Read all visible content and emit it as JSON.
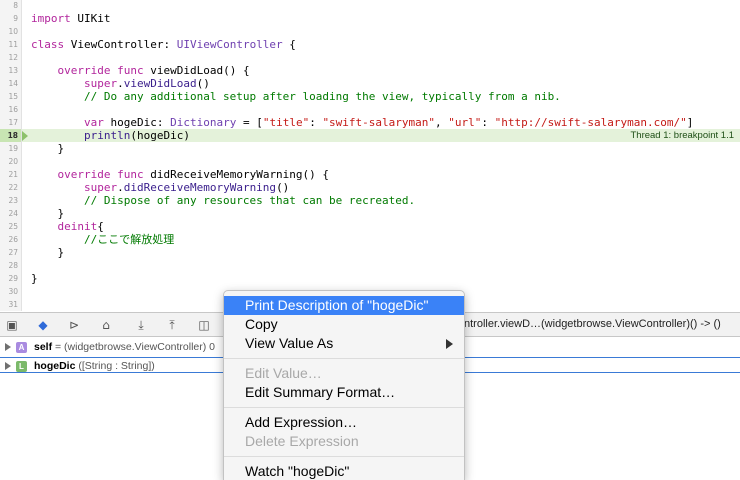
{
  "editor": {
    "lines": [
      {
        "n": "8",
        "tokens": []
      },
      {
        "n": "9",
        "tokens": [
          {
            "c": "kw",
            "t": "import"
          },
          {
            "c": "",
            "t": " UIKit"
          }
        ]
      },
      {
        "n": "10",
        "tokens": []
      },
      {
        "n": "11",
        "tokens": [
          {
            "c": "kw",
            "t": "class"
          },
          {
            "c": "",
            "t": " ViewController: "
          },
          {
            "c": "ty",
            "t": "UIViewController"
          },
          {
            "c": "",
            "t": " {"
          }
        ]
      },
      {
        "n": "12",
        "tokens": []
      },
      {
        "n": "13",
        "tokens": [
          {
            "c": "",
            "t": "    "
          },
          {
            "c": "kw",
            "t": "override"
          },
          {
            "c": "",
            "t": " "
          },
          {
            "c": "kw",
            "t": "func"
          },
          {
            "c": "",
            "t": " viewDidLoad() {"
          }
        ]
      },
      {
        "n": "14",
        "tokens": [
          {
            "c": "",
            "t": "        "
          },
          {
            "c": "kw",
            "t": "super"
          },
          {
            "c": "",
            "t": "."
          },
          {
            "c": "fn",
            "t": "viewDidLoad"
          },
          {
            "c": "",
            "t": "()"
          }
        ]
      },
      {
        "n": "15",
        "tokens": [
          {
            "c": "",
            "t": "        "
          },
          {
            "c": "cm",
            "t": "// Do any additional setup after loading the view, typically from a nib."
          }
        ]
      },
      {
        "n": "16",
        "tokens": []
      },
      {
        "n": "17",
        "tokens": [
          {
            "c": "",
            "t": "        "
          },
          {
            "c": "kw",
            "t": "var"
          },
          {
            "c": "",
            "t": " hogeDic: "
          },
          {
            "c": "ty",
            "t": "Dictionary"
          },
          {
            "c": "",
            "t": " = ["
          },
          {
            "c": "str",
            "t": "\"title\""
          },
          {
            "c": "",
            "t": ": "
          },
          {
            "c": "str",
            "t": "\"swift-salaryman\""
          },
          {
            "c": "",
            "t": ", "
          },
          {
            "c": "str",
            "t": "\"url\""
          },
          {
            "c": "",
            "t": ": "
          },
          {
            "c": "str",
            "t": "\"http://swift-salaryman.com/\""
          },
          {
            "c": "",
            "t": "]"
          }
        ]
      },
      {
        "n": "18",
        "tokens": [
          {
            "c": "",
            "t": "        "
          },
          {
            "c": "fn",
            "t": "println"
          },
          {
            "c": "",
            "t": "(hogeDic)"
          }
        ],
        "current": true
      },
      {
        "n": "19",
        "tokens": [
          {
            "c": "",
            "t": "    }"
          }
        ]
      },
      {
        "n": "20",
        "tokens": []
      },
      {
        "n": "21",
        "tokens": [
          {
            "c": "",
            "t": "    "
          },
          {
            "c": "kw",
            "t": "override"
          },
          {
            "c": "",
            "t": " "
          },
          {
            "c": "kw",
            "t": "func"
          },
          {
            "c": "",
            "t": " didReceiveMemoryWarning() {"
          }
        ]
      },
      {
        "n": "22",
        "tokens": [
          {
            "c": "",
            "t": "        "
          },
          {
            "c": "kw",
            "t": "super"
          },
          {
            "c": "",
            "t": "."
          },
          {
            "c": "fn",
            "t": "didReceiveMemoryWarning"
          },
          {
            "c": "",
            "t": "()"
          }
        ]
      },
      {
        "n": "23",
        "tokens": [
          {
            "c": "",
            "t": "        "
          },
          {
            "c": "cm",
            "t": "// Dispose of any resources that can be recreated."
          }
        ]
      },
      {
        "n": "24",
        "tokens": [
          {
            "c": "",
            "t": "    }"
          }
        ]
      },
      {
        "n": "25",
        "tokens": [
          {
            "c": "",
            "t": "    "
          },
          {
            "c": "kw",
            "t": "deinit"
          },
          {
            "c": "",
            "t": "{"
          }
        ]
      },
      {
        "n": "26",
        "tokens": [
          {
            "c": "",
            "t": "        "
          },
          {
            "c": "cm",
            "t": "//ここで解放処理"
          }
        ]
      },
      {
        "n": "27",
        "tokens": [
          {
            "c": "",
            "t": "    }"
          }
        ]
      },
      {
        "n": "28",
        "tokens": []
      },
      {
        "n": "29",
        "tokens": [
          {
            "c": "",
            "t": "}"
          }
        ]
      },
      {
        "n": "30",
        "tokens": []
      },
      {
        "n": "31",
        "tokens": []
      }
    ],
    "breakpoint_label": "Thread 1: breakpoint 1.1"
  },
  "debugbar": {
    "frame_path": "ntroller.viewD…(widgetbrowse.ViewController)() -> ()"
  },
  "variables": [
    {
      "badge": "A",
      "name": "self",
      "value": " = (widgetbrowse.ViewController) 0"
    },
    {
      "badge": "L",
      "name": "hogeDic",
      "value": " ([String : String])"
    }
  ],
  "context_menu": {
    "items": [
      {
        "label": "Print Description of \"hogeDic\"",
        "highlighted": true
      },
      {
        "label": "Copy"
      },
      {
        "label": "View Value As",
        "submenu": true
      },
      {
        "sep": true
      },
      {
        "label": "Edit Value…",
        "disabled": true
      },
      {
        "label": "Edit Summary Format…"
      },
      {
        "sep": true
      },
      {
        "label": "Add Expression…"
      },
      {
        "label": "Delete Expression",
        "disabled": true
      },
      {
        "sep": true
      },
      {
        "label": "Watch \"hogeDic\""
      }
    ]
  },
  "colors": {
    "highlight": "#3a82f7",
    "current_line": "#e4f2da",
    "keyword": "#b2259c",
    "string": "#c41a16",
    "comment": "#007a00"
  }
}
